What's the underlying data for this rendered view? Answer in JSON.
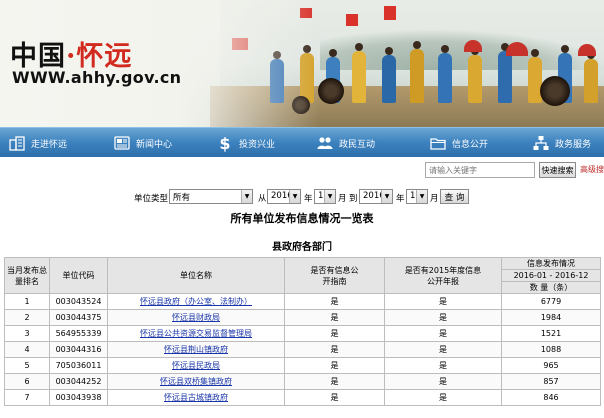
{
  "site": {
    "name_prefix": "中国",
    "name_dot": "·",
    "name_main": "怀远",
    "url": "WWW.ahhy.gov.cn"
  },
  "nav": {
    "items": [
      {
        "label": "走进怀远",
        "icon": "building-icon"
      },
      {
        "label": "新闻中心",
        "icon": "newspaper-icon"
      },
      {
        "label": "投资兴业",
        "icon": "dollar-icon"
      },
      {
        "label": "政民互动",
        "icon": "people-icon"
      },
      {
        "label": "信息公开",
        "icon": "folder-icon"
      },
      {
        "label": "政务服务",
        "icon": "network-icon"
      }
    ]
  },
  "search": {
    "placeholder": "请输入关键字",
    "button": "快速搜索",
    "advanced": "高级搜"
  },
  "filter": {
    "unit_type_label": "单位类型:",
    "unit_type_value": "所有",
    "from_label": "从",
    "from_year": "2016",
    "year_label_1": "年",
    "from_month": "1",
    "month_label_1": "月",
    "to_label": "到",
    "to_year": "2016",
    "year_label_2": "年",
    "to_month": "12",
    "month_label_2": "月",
    "query_button": "查 询"
  },
  "page_title": "所有单位发布信息情况一览表",
  "section_title": "县政府各部门",
  "table": {
    "headers": {
      "rank": "当月发布总量排名",
      "code": "单位代码",
      "name": "单位名称",
      "has_guide": "是否有信息公开指南",
      "has_annual": "是否有2015年度信息公开年报",
      "publish_group": "信息发布情况",
      "period": "2016-01 - 2016-12",
      "count": "数 量（条）"
    },
    "rows": [
      {
        "rank": "1",
        "code": "003043524",
        "name": "怀远县政府（办公室、法制办）",
        "guide": "是",
        "annual": "是",
        "count": "6779"
      },
      {
        "rank": "2",
        "code": "003044375",
        "name": "怀远县财政局",
        "guide": "是",
        "annual": "是",
        "count": "1984"
      },
      {
        "rank": "3",
        "code": "564955339",
        "name": "怀远县公共资源交易监督管理局",
        "guide": "是",
        "annual": "是",
        "count": "1521"
      },
      {
        "rank": "4",
        "code": "003044316",
        "name": "怀远县荆山镇政府",
        "guide": "是",
        "annual": "是",
        "count": "1088"
      },
      {
        "rank": "5",
        "code": "705036011",
        "name": "怀远县民政局",
        "guide": "是",
        "annual": "是",
        "count": "965"
      },
      {
        "rank": "6",
        "code": "003044252",
        "name": "怀远县双桥集镇政府",
        "guide": "是",
        "annual": "是",
        "count": "857"
      },
      {
        "rank": "7",
        "code": "003043938",
        "name": "怀远县古城镇政府",
        "guide": "是",
        "annual": "是",
        "count": "846"
      }
    ]
  }
}
